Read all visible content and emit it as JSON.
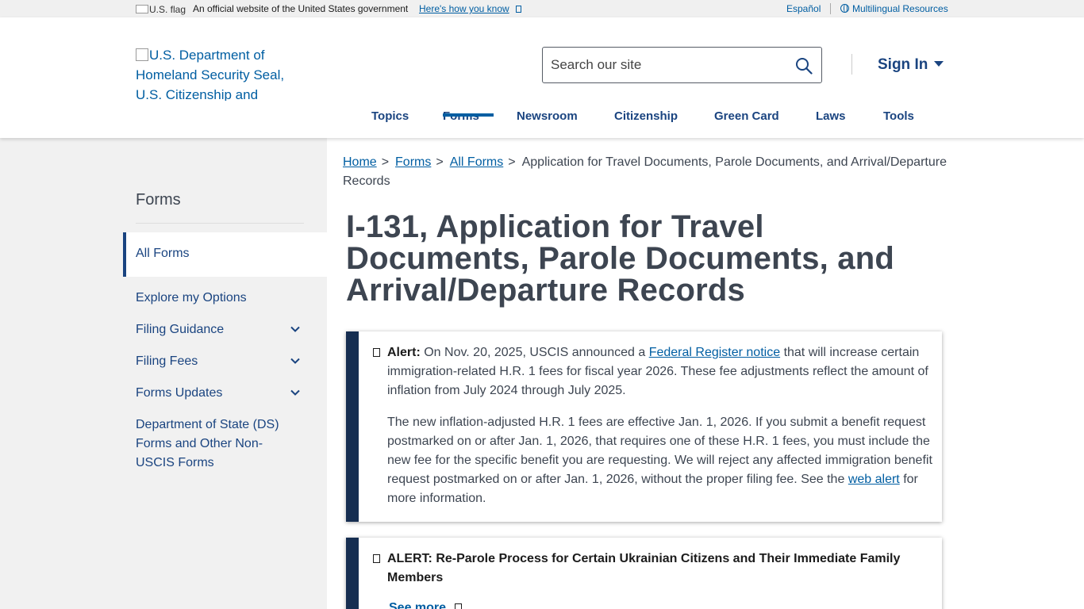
{
  "gov_banner": {
    "flag_alt": "U.S. flag",
    "official_text": "An official website of the United States government",
    "how_link": "Here's how you know",
    "espanol": "Español",
    "multilingual": "Multilingual Resources"
  },
  "header": {
    "logo_alt": "U.S. Department of Homeland Security Seal, U.S. Citizenship and",
    "search_placeholder": "Search our site",
    "sign_in": "Sign In"
  },
  "nav": {
    "items": [
      "Topics",
      "Forms",
      "Newsroom",
      "Citizenship",
      "Green Card",
      "Laws",
      "Tools"
    ],
    "active": "Forms"
  },
  "sidebar": {
    "title": "Forms",
    "active_item": "All Forms",
    "items": [
      "Explore my Options",
      "Filing Guidance",
      "Filing Fees",
      "Forms Updates",
      "Department of State (DS) Forms and Other Non-USCIS Forms"
    ]
  },
  "breadcrumb": {
    "home": "Home",
    "forms": "Forms",
    "all_forms": "All Forms",
    "current": "Application for Travel Documents, Parole Documents, and Arrival/Departure Records",
    "separator": ">"
  },
  "page": {
    "title": "I-131, Application for Travel Documents, Parole Documents, and Arrival/Departure Records"
  },
  "alert1": {
    "label": "Alert:",
    "p1_before": "On Nov. 20, 2025, USCIS announced a",
    "p1_link": "Federal Register notice",
    "p1_after": "that will increase certain immigration-related H.R. 1 fees for fiscal year 2026. These fee adjustments reflect the amount of inflation from July 2024 through July 2025.",
    "p2_before": "The new inflation-adjusted H.R. 1 fees are effective Jan. 1, 2026. If you submit a benefit request postmarked on or after Jan. 1, 2026, that requires one of these H.R. 1 fees, you must include the new fee for the specific benefit you are requesting. We will reject any affected immigration benefit request postmarked on or after Jan. 1, 2026, without the proper filing fee. See the",
    "p2_link": "web alert",
    "p2_after": "for more information."
  },
  "alert2": {
    "heading": "ALERT: Re-Parole Process for Certain Ukrainian Citizens and Their Immediate Family Members",
    "see_more": "See more"
  },
  "colors": {
    "primary_dark": "#1a4480",
    "link": "#005ea2",
    "alert_bar": "#162e51",
    "sidebar_bg": "#f1f1f1",
    "title_text": "#3d4551"
  }
}
